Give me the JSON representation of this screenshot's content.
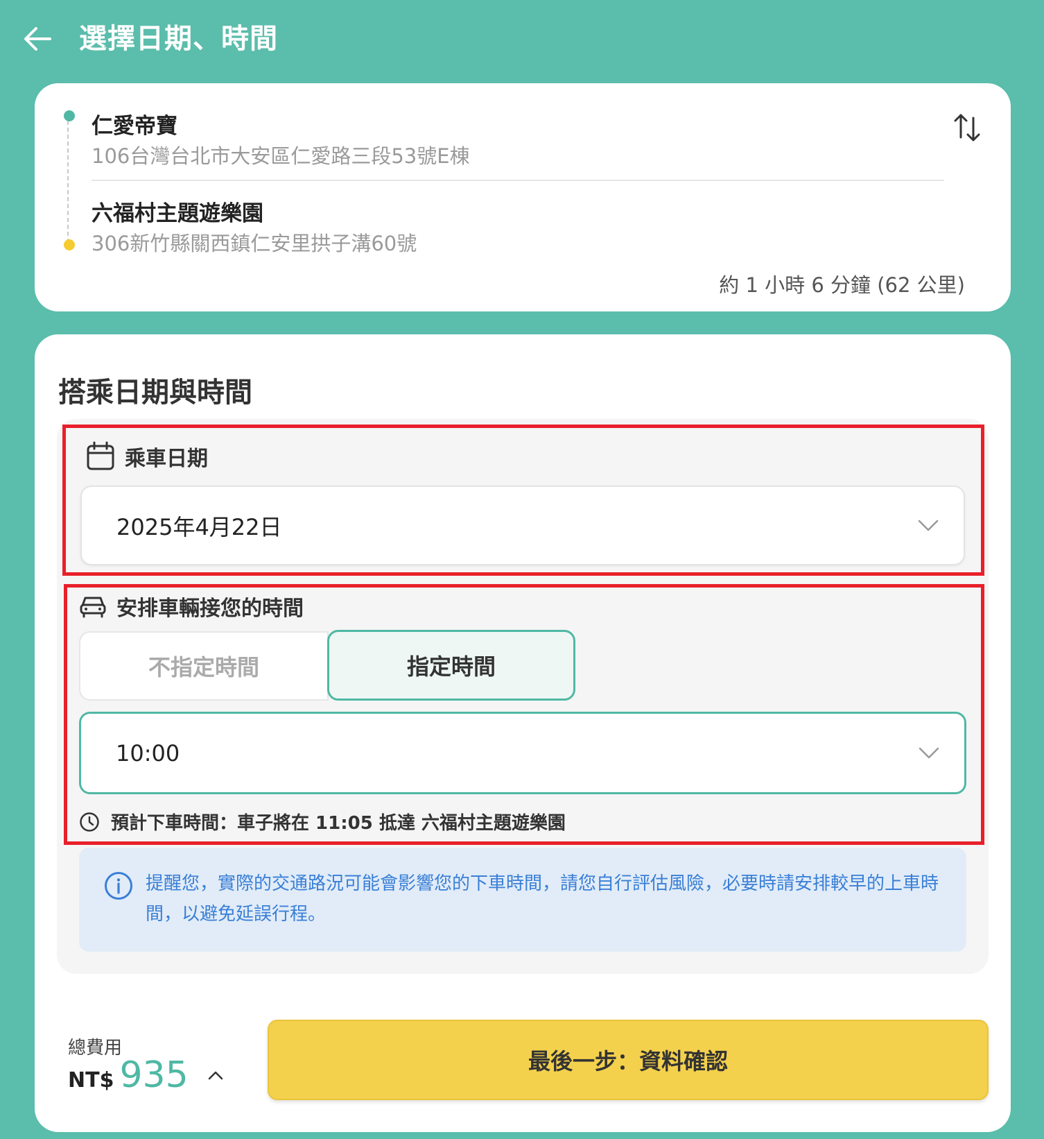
{
  "header": {
    "title": "選擇日期、時間",
    "back_icon": "arrow-left-icon"
  },
  "route": {
    "origin": {
      "name": "仁愛帝寶",
      "address": "106台灣台北市大安區仁愛路三段53號E棟"
    },
    "destination": {
      "name": "六福村主題遊樂園",
      "address": "306新竹縣關西鎮仁安里拱子溝60號"
    },
    "duration": "約 1 小時 6 分鐘 (62 公里)",
    "swap_icon": "swap-vertical-icon",
    "colors": {
      "origin_dot": "#4fb8a4",
      "destination_dot": "#f5cc30"
    }
  },
  "schedule": {
    "title": "搭乘日期與時間",
    "date_label": "乘車日期",
    "date_value": "2025年4月22日",
    "pickup_label": "安排車輛接您的時間",
    "mode_options": [
      "不指定時間",
      "指定時間"
    ],
    "mode_selected": "指定時間",
    "time_value": "10:00",
    "eta_text": "預計下車時間：車子將在 11:05 抵達 六福村主題遊樂園",
    "notice": "提醒您，實際的交通路況可能會影響您的下車時間，請您自行評估風險，必要時請安排較早的上車時間，以避免延誤行程。"
  },
  "footer": {
    "total_label": "總費用",
    "currency": "NT$",
    "price": "935",
    "confirm_label": "最後一步：資料確認"
  },
  "theme": {
    "primary": "#5bbdab",
    "accent": "#4fb8a4",
    "button": "#f4d14d",
    "highlight": "#e8202a",
    "info": "#3a7fd6"
  }
}
